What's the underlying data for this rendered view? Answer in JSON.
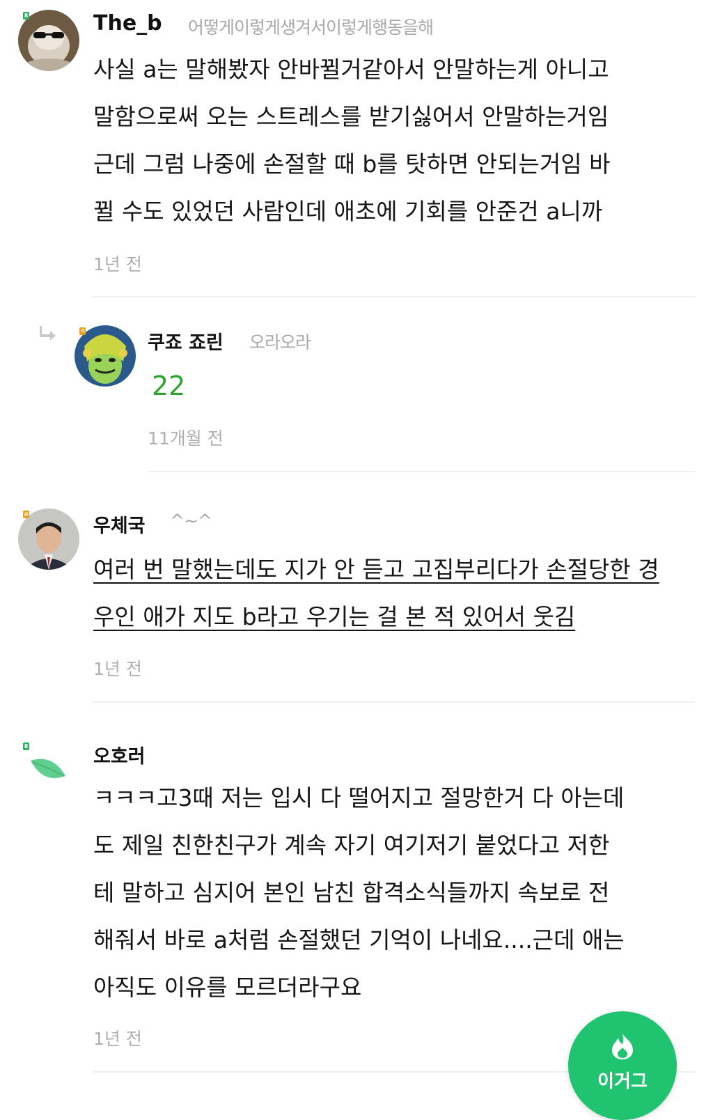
{
  "comments": [
    {
      "name": "The_b",
      "status": "어떻게이렇게생겨서이렇게행동을해",
      "text": "사실 a는 말해봤자 안바뀔거같아서 안말하는게 아니고\n말함으로써 오는 스트레스를 받기싫어서 안말하는거임\n근데 그럼 나중에 손절할 때 b를 탓하면 안되는거임 바\n뀔 수도 있었던 사람인데 애초에 기회를 안준건 a니까",
      "time": "1년 전",
      "level_badge": "8",
      "level_color": "#22b35e"
    },
    {
      "name": "쿠죠 죠린",
      "status": "오라오라",
      "text": "22",
      "text_color": "#2aa52a",
      "time": "11개월 전",
      "level_badge": "ㅋ",
      "level_color": "#e8a21c",
      "is_reply": true,
      "reply_icon": "reply-arrow-icon"
    },
    {
      "name": "우체국",
      "status": "^~^",
      "text": "여러 번 말했는데도 지가 안 듣고 고집부리다가 손절당한 경\n우인 애가 지도 b라고 우기는 걸 본 적 있어서 웃김",
      "time": "1년 전",
      "level_badge": "ㄹ",
      "level_color": "#e8a21c"
    },
    {
      "name": "오호러",
      "status": "",
      "text": "ㅋㅋㅋ고3때 저는 입시 다 떨어지고 절망한거 다 아는데\n도 제일 친한친구가 계속 자기 여기저기 붙었다고 저한\n테 말하고 심지어 본인 남친 합격소식들까지 속보로 전\n해줘서 바로 a처럼 손절했던 기억이 나네요....근데 애는\n아직도 이유를 모르더라구요",
      "time": "1년 전",
      "level_badge": "8",
      "level_color": "#22b35e"
    }
  ],
  "fab": {
    "label": "이거그",
    "icon": "flame-icon",
    "color": "#20c36f"
  }
}
